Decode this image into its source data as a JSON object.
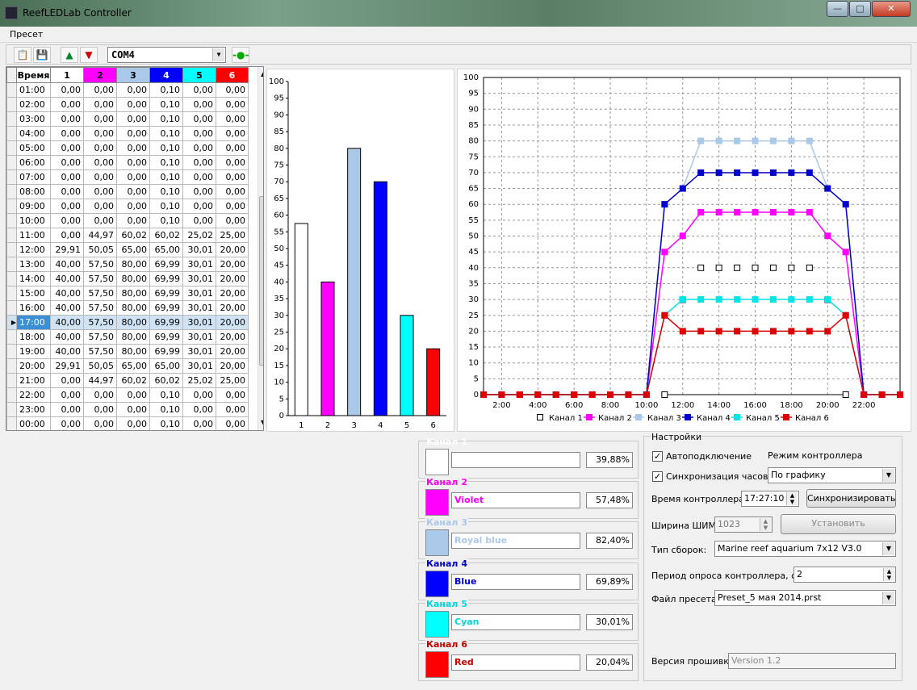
{
  "window": {
    "title": "ReefLEDLab Controller",
    "min": "—",
    "max": "□",
    "close": "✕"
  },
  "menu": {
    "preset": "Пресет"
  },
  "toolbar": {
    "com_port": "COM4"
  },
  "table": {
    "headers": [
      "Время",
      "1",
      "2",
      "3",
      "4",
      "5",
      "6"
    ],
    "header_colors": [
      "#ffffff",
      "#ffffff",
      "#ff00ff",
      "#aac8e8",
      "#0000ff",
      "#00ffff",
      "#ff0000"
    ],
    "header_text_colors": [
      "#000000",
      "#000000",
      "#000000",
      "#000000",
      "#ffffff",
      "#000000",
      "#ffffff"
    ],
    "current_row": 16,
    "rows": [
      [
        "01:00",
        "0,00",
        "0,00",
        "0,00",
        "0,10",
        "0,00",
        "0,00"
      ],
      [
        "02:00",
        "0,00",
        "0,00",
        "0,00",
        "0,10",
        "0,00",
        "0,00"
      ],
      [
        "03:00",
        "0,00",
        "0,00",
        "0,00",
        "0,10",
        "0,00",
        "0,00"
      ],
      [
        "04:00",
        "0,00",
        "0,00",
        "0,00",
        "0,10",
        "0,00",
        "0,00"
      ],
      [
        "05:00",
        "0,00",
        "0,00",
        "0,00",
        "0,10",
        "0,00",
        "0,00"
      ],
      [
        "06:00",
        "0,00",
        "0,00",
        "0,00",
        "0,10",
        "0,00",
        "0,00"
      ],
      [
        "07:00",
        "0,00",
        "0,00",
        "0,00",
        "0,10",
        "0,00",
        "0,00"
      ],
      [
        "08:00",
        "0,00",
        "0,00",
        "0,00",
        "0,10",
        "0,00",
        "0,00"
      ],
      [
        "09:00",
        "0,00",
        "0,00",
        "0,00",
        "0,10",
        "0,00",
        "0,00"
      ],
      [
        "10:00",
        "0,00",
        "0,00",
        "0,00",
        "0,10",
        "0,00",
        "0,00"
      ],
      [
        "11:00",
        "0,00",
        "44,97",
        "60,02",
        "60,02",
        "25,02",
        "25,00"
      ],
      [
        "12:00",
        "29,91",
        "50,05",
        "65,00",
        "65,00",
        "30,01",
        "20,00"
      ],
      [
        "13:00",
        "40,00",
        "57,50",
        "80,00",
        "69,99",
        "30,01",
        "20,00"
      ],
      [
        "14:00",
        "40,00",
        "57,50",
        "80,00",
        "69,99",
        "30,01",
        "20,00"
      ],
      [
        "15:00",
        "40,00",
        "57,50",
        "80,00",
        "69,99",
        "30,01",
        "20,00"
      ],
      [
        "16:00",
        "40,00",
        "57,50",
        "80,00",
        "69,99",
        "30,01",
        "20,00"
      ],
      [
        "17:00",
        "40,00",
        "57,50",
        "80,00",
        "69,99",
        "30,01",
        "20,00"
      ],
      [
        "18:00",
        "40,00",
        "57,50",
        "80,00",
        "69,99",
        "30,01",
        "20,00"
      ],
      [
        "19:00",
        "40,00",
        "57,50",
        "80,00",
        "69,99",
        "30,01",
        "20,00"
      ],
      [
        "20:00",
        "29,91",
        "50,05",
        "65,00",
        "65,00",
        "30,01",
        "20,00"
      ],
      [
        "21:00",
        "0,00",
        "44,97",
        "60,02",
        "60,02",
        "25,02",
        "25,00"
      ],
      [
        "22:00",
        "0,00",
        "0,00",
        "0,00",
        "0,10",
        "0,00",
        "0,00"
      ],
      [
        "23:00",
        "0,00",
        "0,00",
        "0,00",
        "0,10",
        "0,00",
        "0,00"
      ],
      [
        "00:00",
        "0,00",
        "0,00",
        "0,00",
        "0,10",
        "0,00",
        "0,00"
      ]
    ]
  },
  "chart_data": [
    {
      "type": "bar",
      "categories": [
        "1",
        "2",
        "3",
        "4",
        "5",
        "6"
      ],
      "values": [
        57.5,
        40,
        80,
        70,
        30,
        20
      ],
      "colors": [
        "#ffffff",
        "#ff00ff",
        "#aac8e8",
        "#0000ff",
        "#00ffff",
        "#ff0000"
      ],
      "ylim": [
        0,
        100
      ],
      "yticks": [
        0,
        5,
        10,
        15,
        20,
        25,
        30,
        35,
        40,
        45,
        50,
        55,
        60,
        65,
        70,
        75,
        80,
        85,
        90,
        95,
        100
      ]
    },
    {
      "type": "line",
      "xlim": [
        0,
        23
      ],
      "xticks": [
        {
          "v": 1,
          "label": "2:00"
        },
        {
          "v": 3,
          "label": "4:00"
        },
        {
          "v": 5,
          "label": "6:00"
        },
        {
          "v": 7,
          "label": "8:00"
        },
        {
          "v": 9,
          "label": "10:00"
        },
        {
          "v": 11,
          "label": "12:00"
        },
        {
          "v": 13,
          "label": "14:00"
        },
        {
          "v": 15,
          "label": "16:00"
        },
        {
          "v": 17,
          "label": "18:00"
        },
        {
          "v": 19,
          "label": "20:00"
        },
        {
          "v": 21,
          "label": "22:00"
        }
      ],
      "ylim": [
        0,
        100
      ],
      "yticks": [
        0,
        5,
        10,
        15,
        20,
        25,
        30,
        35,
        40,
        45,
        50,
        55,
        60,
        65,
        70,
        75,
        80,
        85,
        90,
        95,
        100
      ],
      "grid": true,
      "legend_position": "bottom",
      "series": [
        {
          "name": "Канал 1",
          "color": "#ffffff",
          "marker": "#000000",
          "values": [
            0,
            0,
            0,
            0,
            0,
            0,
            0,
            0,
            0,
            0,
            0,
            29.91,
            40,
            40,
            40,
            40,
            40,
            40,
            40,
            29.91,
            0,
            0,
            0,
            0
          ]
        },
        {
          "name": "Канал 2",
          "color": "#ff00ff",
          "marker": "#ff00ff",
          "values": [
            0,
            0,
            0,
            0,
            0,
            0,
            0,
            0,
            0,
            0,
            44.97,
            50.05,
            57.5,
            57.5,
            57.5,
            57.5,
            57.5,
            57.5,
            57.5,
            50.05,
            44.97,
            0,
            0,
            0
          ]
        },
        {
          "name": "Канал 3",
          "color": "#aac8e8",
          "marker": "#aac8e8",
          "values": [
            0,
            0,
            0,
            0,
            0,
            0,
            0,
            0,
            0,
            0,
            60.02,
            65,
            80,
            80,
            80,
            80,
            80,
            80,
            80,
            65,
            60.02,
            0,
            0,
            0
          ]
        },
        {
          "name": "Канал 4",
          "color": "#0000cc",
          "marker": "#0000cc",
          "values": [
            0,
            0,
            0,
            0,
            0,
            0,
            0,
            0,
            0,
            0,
            60.02,
            65,
            69.99,
            69.99,
            69.99,
            69.99,
            69.99,
            69.99,
            69.99,
            65,
            60.02,
            0,
            0,
            0
          ]
        },
        {
          "name": "Канал 5",
          "color": "#00e5e5",
          "marker": "#00e5e5",
          "values": [
            0,
            0,
            0,
            0,
            0,
            0,
            0,
            0,
            0,
            0,
            25.02,
            30.01,
            30.01,
            30.01,
            30.01,
            30.01,
            30.01,
            30.01,
            30.01,
            30.01,
            25.02,
            0,
            0,
            0
          ]
        },
        {
          "name": "Канал 6",
          "color": "#dd0000",
          "marker": "#dd0000",
          "values": [
            0,
            0,
            0,
            0,
            0,
            0,
            0,
            0,
            0,
            0,
            25,
            20,
            20,
            20,
            20,
            20,
            20,
            20,
            20,
            20,
            25,
            0,
            0,
            0
          ]
        }
      ]
    }
  ],
  "channels": [
    {
      "title": "Канал 1",
      "name": "",
      "value": "39,88%",
      "color": "#ffffff",
      "text_color": "#ffffff"
    },
    {
      "title": "Канал 2",
      "name": "Violet",
      "value": "57,48%",
      "color": "#ff00ff",
      "text_color": "#ff00ff"
    },
    {
      "title": "Канал 3",
      "name": "Royal blue",
      "value": "82,40%",
      "color": "#aac8e8",
      "text_color": "#aac8e8"
    },
    {
      "title": "Канал 4",
      "name": "Blue",
      "value": "69,89%",
      "color": "#0000ff",
      "text_color": "#0000cc"
    },
    {
      "title": "Канал 5",
      "name": "Cyan",
      "value": "30,01%",
      "color": "#00ffff",
      "text_color": "#00d8d8"
    },
    {
      "title": "Канал 6",
      "name": "Red",
      "value": "20,04%",
      "color": "#ff0000",
      "text_color": "#cc0000"
    }
  ],
  "settings": {
    "title": "Настройки",
    "autoconnect": "Автоподключение",
    "mode_label": "Режим контроллера",
    "sync_clock": "Синхронизация часов",
    "mode_value": "По графику",
    "time_label": "Время контроллера:",
    "time_value": "17:27:10",
    "sync_button": "Синхронизировать",
    "pwm_label": "Ширина ШИМ:",
    "pwm_value": "1023",
    "set_button": "Установить",
    "assembly_label": "Тип сборок:",
    "assembly_value": "Marine reef aquarium 7x12 V3.0",
    "poll_label": "Период опроса контроллера, сек:",
    "poll_value": "2",
    "preset_label": "Файл пресета:",
    "preset_value": "Preset_5 мая 2014.prst",
    "firmware_label": "Версия прошивки:",
    "firmware_value": "Version 1.2"
  }
}
